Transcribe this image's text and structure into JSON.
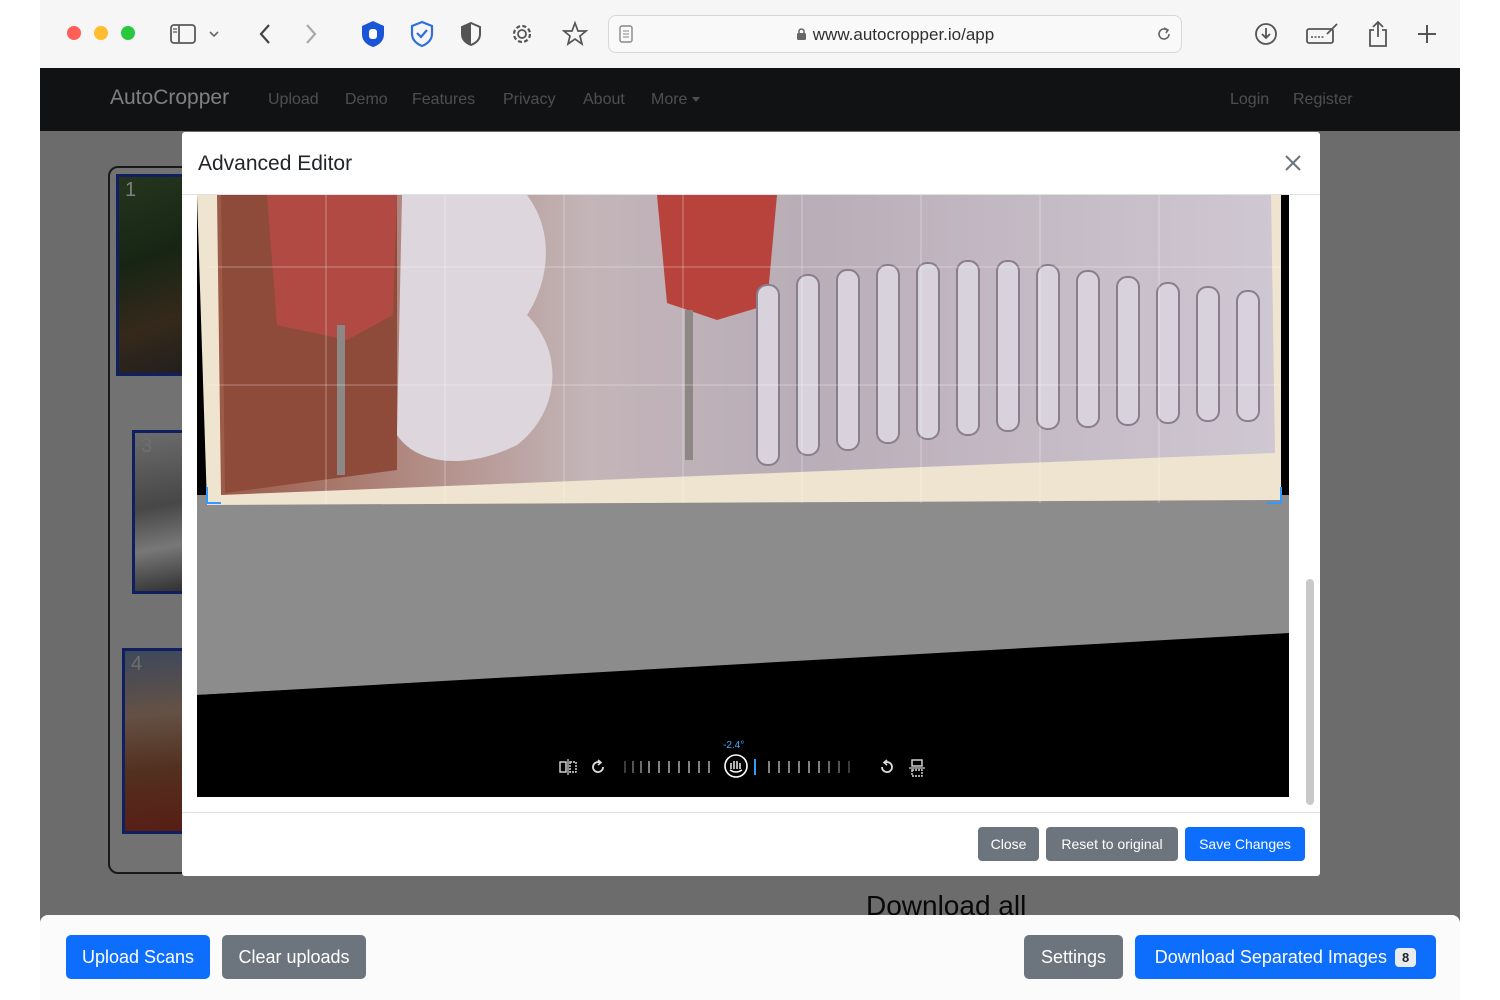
{
  "browser": {
    "url": "www.autocropper.io/app"
  },
  "navbar": {
    "brand": "AutoCropper",
    "links": [
      "Upload",
      "Demo",
      "Features",
      "Privacy",
      "About",
      "More"
    ],
    "login": "Login",
    "register": "Register"
  },
  "sidebar": {
    "thumbnails": [
      {
        "number": "1"
      },
      {
        "number": "3"
      },
      {
        "number": "4"
      }
    ]
  },
  "main": {
    "download_all_heading": "Download all"
  },
  "modal": {
    "title": "Advanced Editor",
    "rotation_readout": "-2.4°",
    "buttons": {
      "close": "Close",
      "reset": "Reset to original",
      "save": "Save Changes"
    }
  },
  "bottom_bar": {
    "upload": "Upload Scans",
    "clear": "Clear uploads",
    "settings": "Settings",
    "download": "Download Separated Images",
    "download_count": "8"
  },
  "colors": {
    "primary": "#0d6efd",
    "secondary": "#6c757d",
    "navbar": "#212529",
    "selection_border": "#1f3fbf"
  },
  "icons": {
    "toolbar": [
      "sidebar-icon",
      "chevron-down-icon",
      "back-arrow-icon",
      "forward-arrow-icon",
      "hand-shield-icon",
      "bitwarden-shield-icon",
      "privacy-shield-icon",
      "gear-icon",
      "star-icon",
      "reader-icon",
      "lock-icon",
      "reload-icon",
      "download-icon",
      "compose-icon",
      "share-icon",
      "new-tab-plus-icon"
    ],
    "editor": [
      "flip-horizontal-icon",
      "rotate-right-icon",
      "rotation-handle-icon",
      "rotate-left-icon",
      "flip-vertical-icon"
    ]
  }
}
